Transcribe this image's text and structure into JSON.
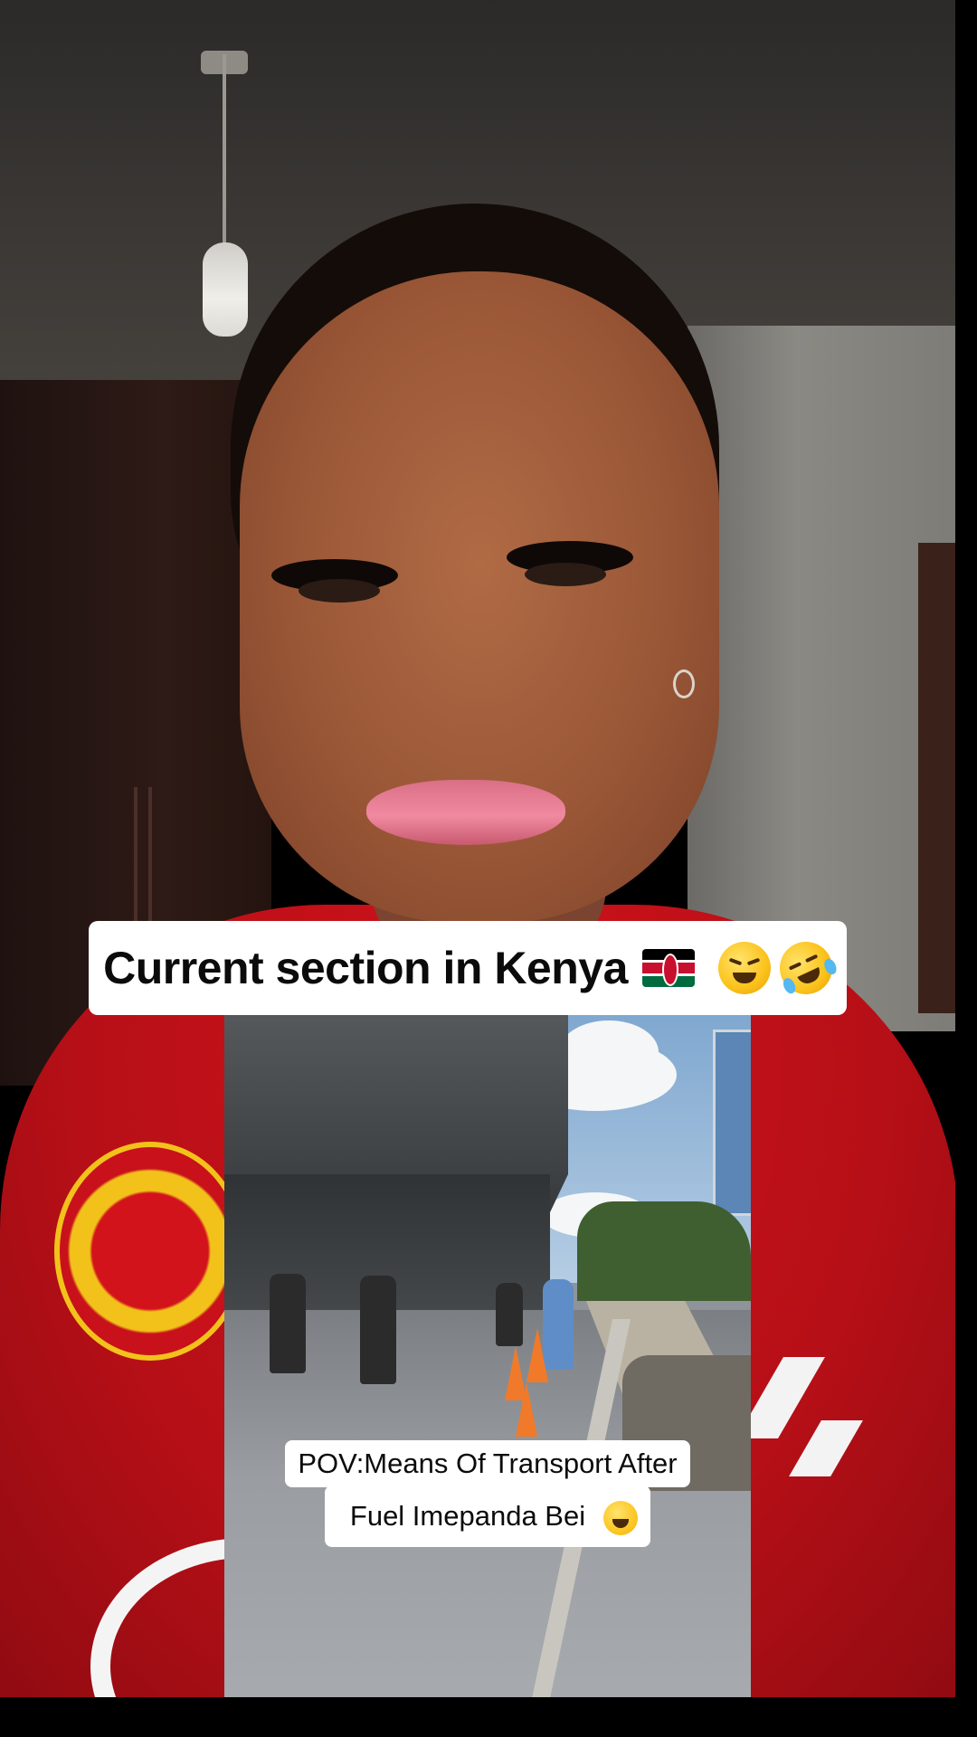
{
  "video": {
    "top_caption": {
      "text": "Current section in Kenya",
      "emojis": [
        "kenya-flag-icon",
        "tired-face-emoji-icon",
        "rolling-laughing-emoji-icon"
      ]
    },
    "embedded_clip": {
      "caption_line1": "POV:Means Of Transport After",
      "caption_line2": "Fuel Imepanda Bei",
      "caption_emoji": "tears-of-joy-emoji-icon"
    }
  },
  "colors": {
    "shirt_red": "#c8111a",
    "caption_bg": "#ffffff",
    "caption_text": "#0b0b0b",
    "flag_black": "#000000",
    "flag_red": "#c8102e",
    "flag_green": "#006b3f"
  }
}
